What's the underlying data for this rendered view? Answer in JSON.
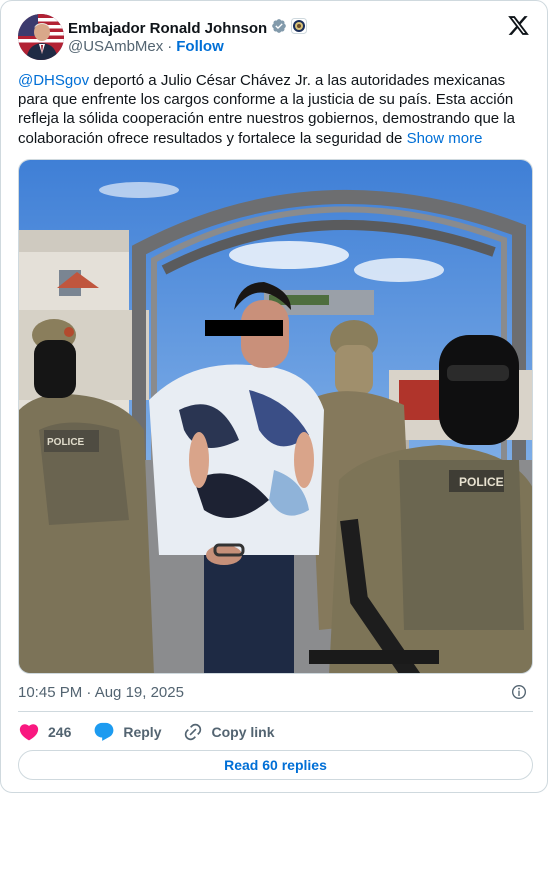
{
  "author": {
    "display_name": "Embajador Ronald Johnson",
    "handle": "@USAmbMex",
    "separator": "·",
    "follow_label": "Follow",
    "verified": true
  },
  "tweet": {
    "mention": "@DHSgov",
    "body": " deportó a Julio César Chávez Jr. a las autoridades mexicanas para que enfrente los cargos conforme a la justicia de su país.  Esta acción refleja la sólida cooperación entre nuestros gobiernos, demostrando que la colaboración ofrece resultados y fortalece la seguridad de ",
    "show_more": "Show more"
  },
  "media": {
    "vest_label_left": "POLICE",
    "vest_label_right": "POLICE"
  },
  "meta": {
    "timestamp": "10:45 PM · Aug 19, 2025"
  },
  "actions": {
    "like_count": "246",
    "reply_label": "Reply",
    "copy_label": "Copy link"
  },
  "read_replies_label": "Read 60 replies",
  "colors": {
    "link": "#006fd6",
    "like": "#f91880",
    "reply": "#1d9bf0",
    "border": "#cfd9de",
    "secondary_text": "#536471"
  },
  "icons": [
    "verified-badge-icon",
    "affiliate-seal-icon",
    "x-logo-icon",
    "info-icon",
    "heart-icon",
    "reply-bubble-icon",
    "link-icon"
  ]
}
